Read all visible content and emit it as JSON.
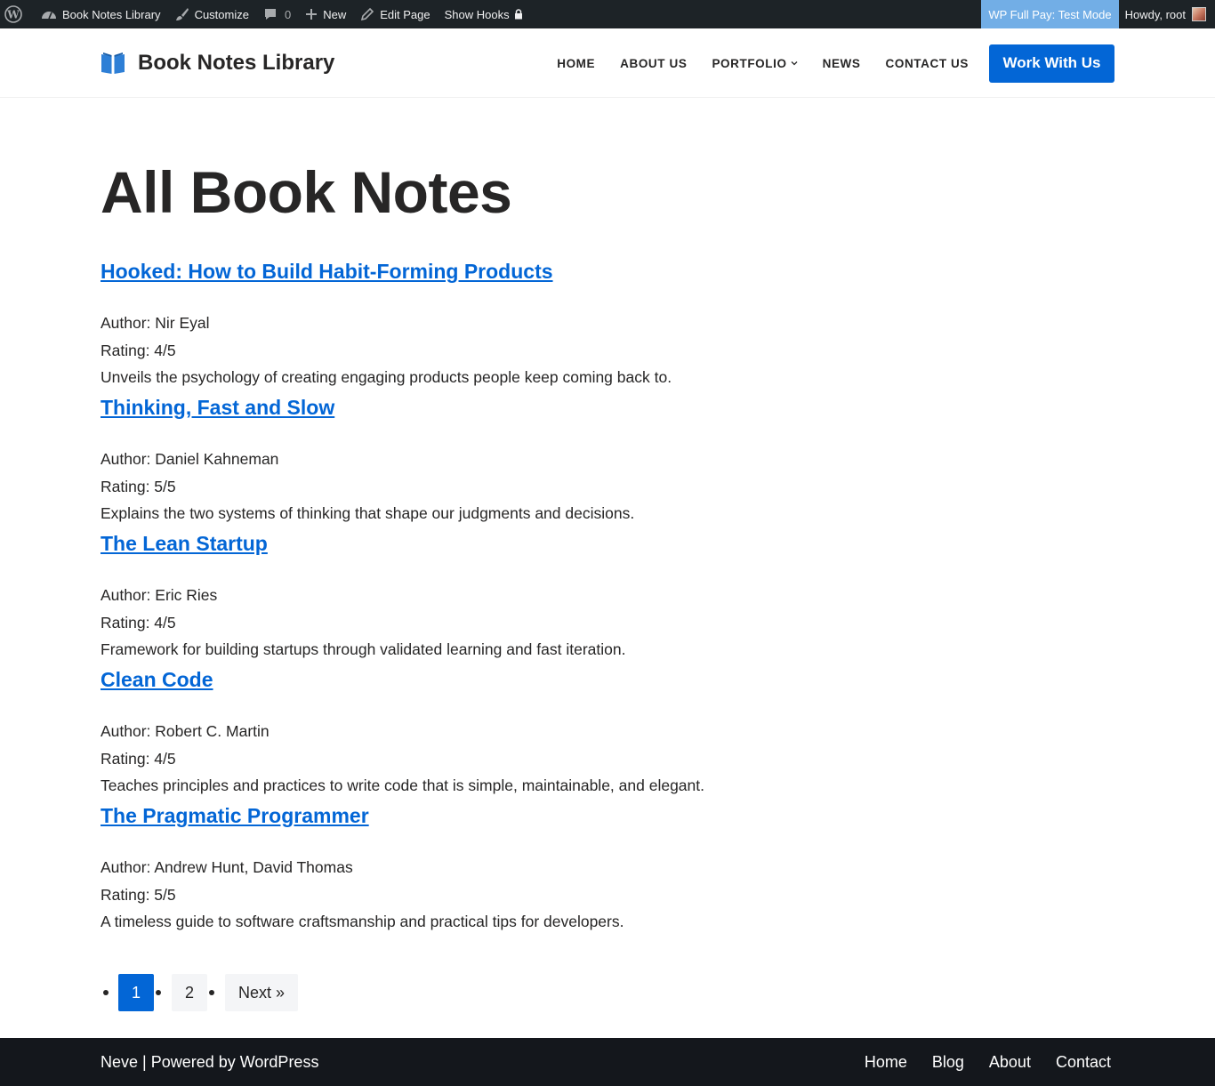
{
  "admin_bar": {
    "site_name": "Book Notes Library",
    "customize": "Customize",
    "comments_count": "0",
    "new": "New",
    "edit_page": "Edit Page",
    "show_hooks": "Show Hooks",
    "test_mode": "WP Full Pay: Test Mode",
    "howdy": "Howdy, root"
  },
  "header": {
    "site_title": "Book Notes Library",
    "nav": {
      "home": "HOME",
      "about": "ABOUT US",
      "portfolio": "PORTFOLIO",
      "news": "NEWS",
      "contact": "CONTACT US"
    },
    "cta": "Work With Us"
  },
  "main": {
    "title": "All Book Notes",
    "books": [
      {
        "title": "Hooked: How to Build Habit-Forming Products",
        "author": "Author: Nir Eyal",
        "rating": "Rating: 4/5",
        "summary": "Unveils the psychology of creating engaging products people keep coming back to."
      },
      {
        "title": "Thinking, Fast and Slow",
        "author": "Author: Daniel Kahneman",
        "rating": "Rating: 5/5",
        "summary": "Explains the two systems of thinking that shape our judgments and decisions."
      },
      {
        "title": "The Lean Startup",
        "author": "Author: Eric Ries",
        "rating": "Rating: 4/5",
        "summary": "Framework for building startups through validated learning and fast iteration."
      },
      {
        "title": "Clean Code",
        "author": "Author: Robert C. Martin",
        "rating": "Rating: 4/5",
        "summary": "Teaches principles and practices to write code that is simple, maintainable, and elegant."
      },
      {
        "title": "The Pragmatic Programmer",
        "author": "Author: Andrew Hunt, David Thomas",
        "rating": "Rating: 5/5",
        "summary": "A timeless guide to software craftsmanship and practical tips for developers."
      }
    ],
    "pagination": {
      "current": "1",
      "page2": "2",
      "next": "Next »"
    }
  },
  "footer": {
    "credit": "Neve | Powered by WordPress",
    "links": {
      "home": "Home",
      "blog": "Blog",
      "about": "About",
      "contact": "Contact"
    }
  },
  "colors": {
    "accent": "#0366d6",
    "admin_bar": "#1d2327",
    "test_mode": "#72aee6",
    "footer": "#14171c",
    "text": "#272626"
  }
}
